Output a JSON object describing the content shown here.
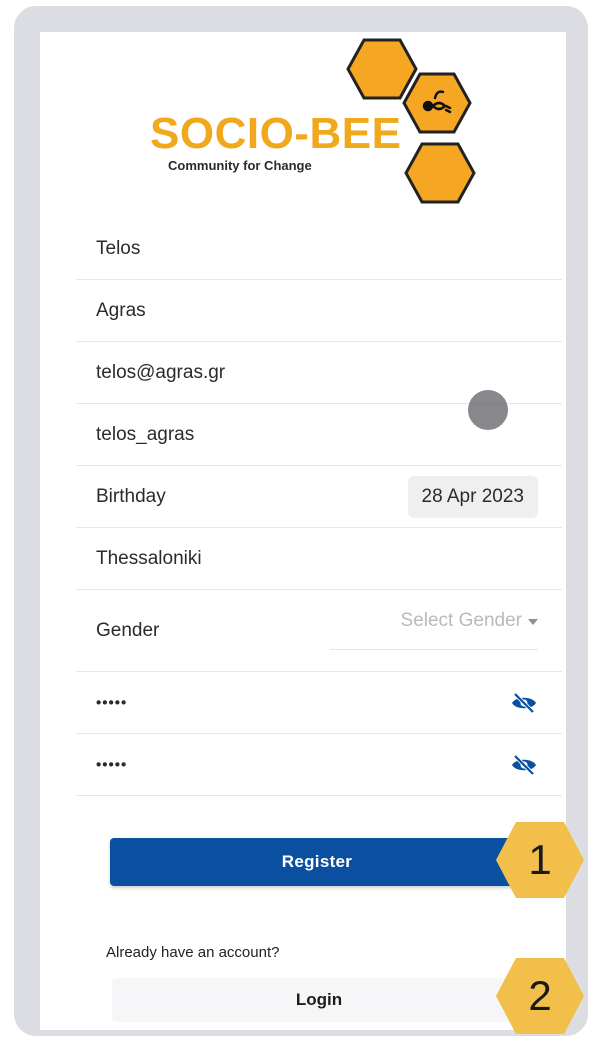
{
  "logo": {
    "name": "SOCIO-BEE",
    "tagline": "Community for Change",
    "colors": {
      "text": "#f0a81c",
      "hex_fill": "#f5a623",
      "hex_stroke": "#222222"
    },
    "icon": "bee-icon"
  },
  "form": {
    "first_name_value": "Telos",
    "last_name_value": "Agras",
    "email_value": "telos@agras.gr",
    "username_value": "telos_agras",
    "birthday_label": "Birthday",
    "birthday_value": "28 Apr 2023",
    "city_value": "Thessaloniki",
    "gender_label": "Gender",
    "gender_placeholder": "Select Gender",
    "password_value": "•••••",
    "confirm_password_value": "•••••",
    "password_toggle_icon": "eye-slash-icon"
  },
  "actions": {
    "register_label": "Register",
    "register_color": "#0b4fa1",
    "already_text": "Already have an account?",
    "login_label": "Login"
  },
  "markers": [
    {
      "number": "1",
      "color": "#f2c04a"
    },
    {
      "number": "2",
      "color": "#f2c04a"
    }
  ]
}
